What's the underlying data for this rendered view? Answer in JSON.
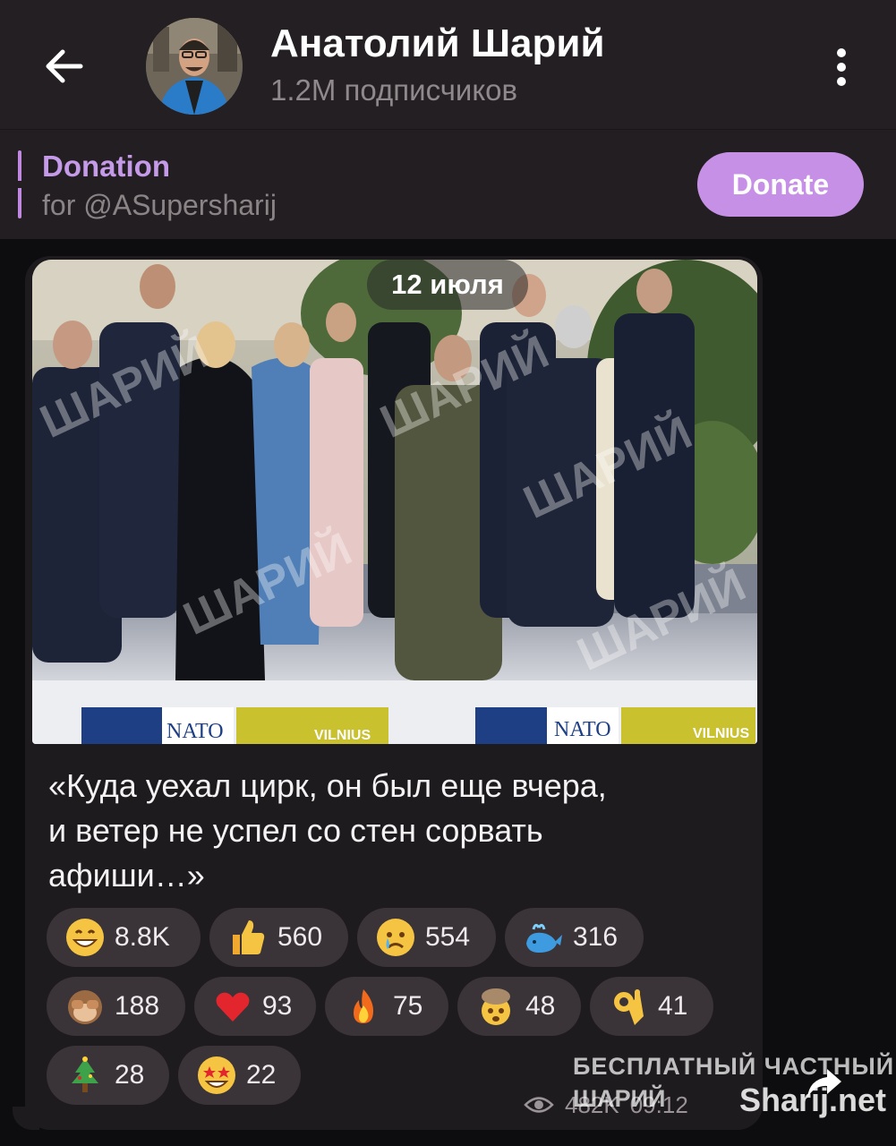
{
  "header": {
    "title": "Анатолий Шарий",
    "subtitle": "1.2M подписчиков",
    "back_icon": "arrow-left-icon",
    "menu_icon": "more-vertical-icon"
  },
  "donation": {
    "title": "Donation",
    "subtitle": "for @ASupersharij",
    "button_label": "Donate",
    "accent_color": "#c690e6"
  },
  "post": {
    "date": "12 июля",
    "photo_watermark": "ШАРИЙ",
    "photo_banner_left": "NATO",
    "photo_banner_right": "VILNIUS",
    "caption_lines": [
      "«Куда уехал цирк, он был еще вчера,",
      "и ветер не успел со стен сорвать",
      "афиши…»"
    ],
    "reactions": [
      {
        "emoji": "😁",
        "icon": "grin-emoji",
        "count": "8.8K"
      },
      {
        "emoji": "👍",
        "icon": "thumbs-up-emoji",
        "count": "560"
      },
      {
        "emoji": "😢",
        "icon": "crying-face-emoji",
        "count": "554"
      },
      {
        "emoji": "🐳",
        "icon": "whale-emoji",
        "count": "316"
      },
      {
        "emoji": "🙈",
        "icon": "see-no-evil-emoji",
        "count": "188"
      },
      {
        "emoji": "❤️",
        "icon": "heart-emoji",
        "count": "93"
      },
      {
        "emoji": "🔥",
        "icon": "fire-emoji",
        "count": "75"
      },
      {
        "emoji": "🤯",
        "icon": "mind-blown-emoji",
        "count": "48"
      },
      {
        "emoji": "👌",
        "icon": "ok-hand-emoji",
        "count": "41"
      },
      {
        "emoji": "🎄",
        "icon": "christmas-tree-emoji",
        "count": "28"
      },
      {
        "emoji": "🤩",
        "icon": "star-struck-emoji",
        "count": "22"
      }
    ],
    "views": "482K",
    "time": "09:12",
    "share_icon": "share-icon"
  },
  "overlay_watermark": {
    "line1": "БЕСПЛАТНЫЙ ЧАСТНЫЙ",
    "line2": "ШАРИЙ",
    "site": "Sharij.net"
  }
}
